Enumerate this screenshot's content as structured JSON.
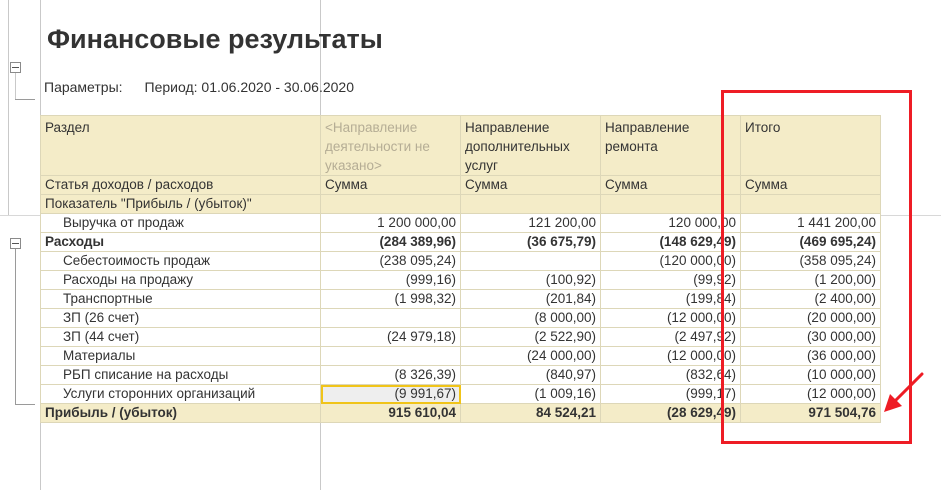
{
  "report": {
    "title": "Финансовые результаты",
    "params_label": "Параметры:",
    "period": "Период: 01.06.2020 - 30.06.2020"
  },
  "header": {
    "section": "Раздел",
    "directions": [
      "<Направление деятельности не указано>",
      "Направление дополнительных услуг",
      "Направление ремонта",
      "Итого"
    ],
    "article_label": "Статья доходов / расходов",
    "sum_labels": [
      "Сумма",
      "Сумма",
      "Сумма",
      "Сумма"
    ],
    "indicator_label": "Показатель \"Прибыль / (убыток)\""
  },
  "rows": [
    {
      "name": "Выручка от продаж",
      "values": [
        "1 200 000,00",
        "121 200,00",
        "120 000,00",
        "1 441 200,00"
      ]
    },
    {
      "name": "Расходы",
      "values": [
        "(284 389,96)",
        "(36 675,79)",
        "(148 629,49)",
        "(469 695,24)"
      ]
    },
    {
      "name": "Себестоимость продаж",
      "values": [
        "(238 095,24)",
        "",
        "(120 000,00)",
        "(358 095,24)"
      ]
    },
    {
      "name": "Расходы на продажу",
      "values": [
        "(999,16)",
        "(100,92)",
        "(99,92)",
        "(1 200,00)"
      ]
    },
    {
      "name": "Транспортные",
      "values": [
        "(1 998,32)",
        "(201,84)",
        "(199,84)",
        "(2 400,00)"
      ]
    },
    {
      "name": "ЗП (26 счет)",
      "values": [
        "",
        "(8 000,00)",
        "(12 000,00)",
        "(20 000,00)"
      ]
    },
    {
      "name": "ЗП (44 счет)",
      "values": [
        "(24 979,18)",
        "(2 522,90)",
        "(2 497,92)",
        "(30 000,00)"
      ]
    },
    {
      "name": "Материалы",
      "values": [
        "",
        "(24 000,00)",
        "(12 000,00)",
        "(36 000,00)"
      ]
    },
    {
      "name": "РБП списание на расходы",
      "values": [
        "(8 326,39)",
        "(840,97)",
        "(832,64)",
        "(10 000,00)"
      ]
    },
    {
      "name": "Услуги сторонних организаций",
      "values": [
        "(9 991,67)",
        "(1 009,16)",
        "(999,17)",
        "(12 000,00)"
      ]
    },
    {
      "name": "Прибыль / (убыток)",
      "values": [
        "915 610,04",
        "84 524,21",
        "(28 629,49)",
        "971 504,76"
      ]
    }
  ],
  "colors": {
    "header_bg": "#f4ecc8",
    "highlight": "#ee1c25",
    "selection": "#f0c419"
  }
}
